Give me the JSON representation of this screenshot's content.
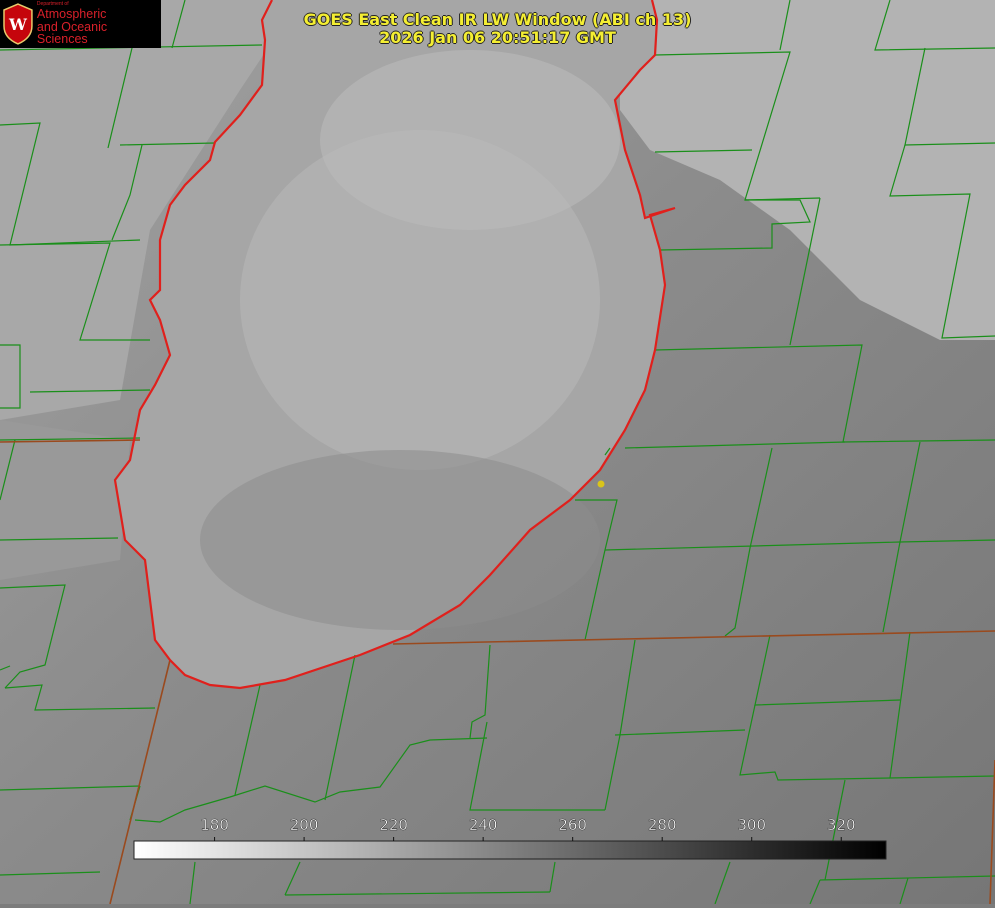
{
  "title": {
    "line1": "GOES East Clean IR LW Window (ABI ch 13)",
    "line2": "2026 Jan 06 20:51:17 GMT"
  },
  "logo": {
    "seal_letter": "W",
    "dept_label": "Department of",
    "line1": "Atmospheric",
    "line2": "and Oceanic Sciences"
  },
  "colorbar": {
    "ticks": [
      "180",
      "200",
      "220",
      "240",
      "260",
      "280",
      "300",
      "320"
    ],
    "tick_values": [
      180,
      200,
      220,
      240,
      260,
      280,
      300,
      320
    ],
    "range": [
      162,
      330
    ],
    "colormap": "grayscale, white (cold) to black (warm)"
  },
  "colors": {
    "title": "#f4ee32",
    "county_lines": "#1a8f1a",
    "coastline": "#e0201c",
    "state_lines": "#9a4a1e",
    "marker": "#d9c41a"
  }
}
